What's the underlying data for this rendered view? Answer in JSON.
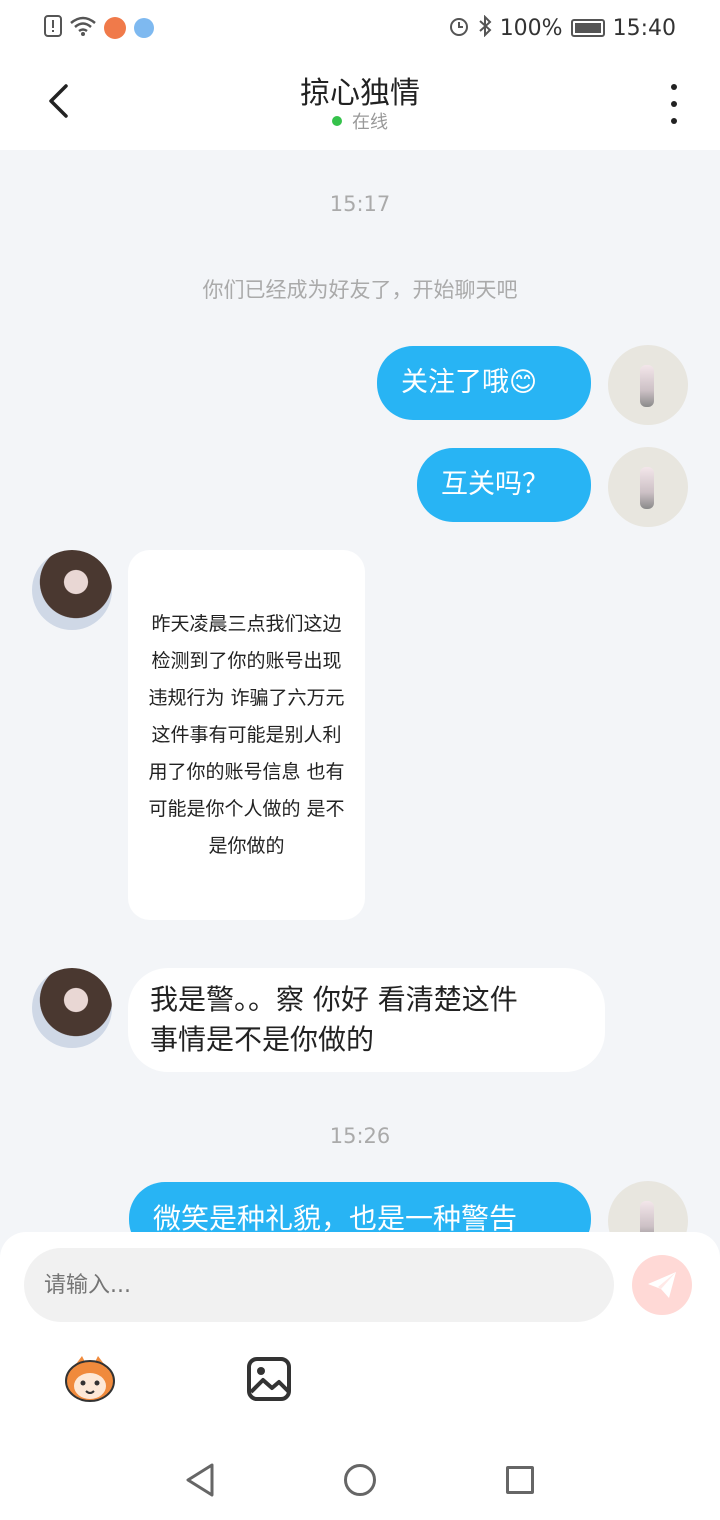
{
  "status_bar": {
    "battery": "100%",
    "time": "15:40"
  },
  "header": {
    "title": "掠心独情",
    "online_status": "在线"
  },
  "chat": {
    "time_1": "15:17",
    "system_message": "你们已经成为好友了，开始聊天吧",
    "messages": [
      {
        "side": "out",
        "text": "关注了哦😊"
      },
      {
        "side": "out",
        "text": "互关吗？"
      },
      {
        "side": "in",
        "lines": [
          "昨天凌晨三点我们这边",
          "检测到了你的账号出现",
          "违规行为 诈骗了六万元",
          "这件事有可能是别人利",
          "用了你的账号信息 也有",
          "可能是你个人做的 是不",
          "是你做的"
        ]
      },
      {
        "side": "in",
        "lines": [
          "我是警。。察 你好 看清楚这件",
          "事情是不是你做的"
        ]
      },
      {
        "side": "out",
        "text": "微笑是种礼貌，也是一种警告"
      }
    ],
    "time_2": "15:26"
  },
  "input": {
    "placeholder": "请输入..."
  },
  "colors": {
    "accent": "#28b4f4",
    "online": "#35c24b",
    "send_button": "#ffd9d6"
  },
  "icons": {
    "back": "chevron-left-icon",
    "more": "more-vertical-icon",
    "send": "paper-plane-icon",
    "emoji": "emoji-sticker-icon",
    "image": "image-icon"
  }
}
